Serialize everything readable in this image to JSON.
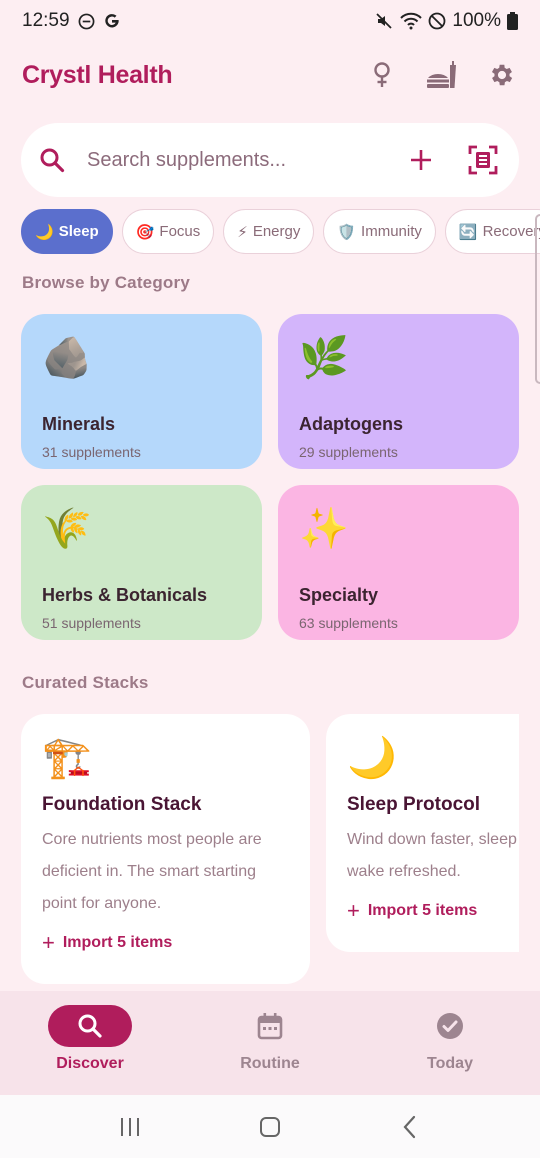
{
  "status_bar": {
    "time": "12:59",
    "battery": "100%"
  },
  "app": {
    "title": "Crystl Health"
  },
  "search": {
    "placeholder": "Search supplements..."
  },
  "chips": [
    {
      "emoji": "🌙",
      "label": "Sleep",
      "active": true
    },
    {
      "emoji": "🎯",
      "label": "Focus",
      "active": false
    },
    {
      "emoji": "⚡",
      "label": "Energy",
      "active": false
    },
    {
      "emoji": "🛡️",
      "label": "Immunity",
      "active": false
    },
    {
      "emoji": "🔄",
      "label": "Recovery",
      "active": false
    }
  ],
  "browse": {
    "title": "Browse by Category",
    "categories": [
      {
        "emoji": "🪨",
        "name": "Minerals",
        "count": "31 supplements",
        "color": "#b5d8fb"
      },
      {
        "emoji": "🌿",
        "name": "Adaptogens",
        "count": "29 supplements",
        "color": "#d3b5fb"
      },
      {
        "emoji": "🌾",
        "name": "Herbs & Botanicals",
        "count": "51 supplements",
        "color": "#cde8c8"
      },
      {
        "emoji": "✨",
        "name": "Specialty",
        "count": "63 supplements",
        "color": "#fbb5e3"
      }
    ]
  },
  "curated": {
    "title": "Curated Stacks",
    "stacks": [
      {
        "emoji": "🏗️",
        "name": "Foundation Stack",
        "desc_lines": [
          "Core nutrients most people are",
          "deficient in. The smart starting",
          "point for anyone."
        ],
        "import_label": "Import 5 items"
      },
      {
        "emoji": "🌙",
        "name": "Sleep Protocol",
        "desc_lines": [
          "Wind down faster, sleep",
          "wake refreshed."
        ],
        "import_label": "Import 5 items"
      }
    ]
  },
  "bottom_nav": [
    {
      "label": "Discover",
      "icon": "search-icon",
      "active": true
    },
    {
      "label": "Routine",
      "icon": "calendar-icon",
      "active": false
    },
    {
      "label": "Today",
      "icon": "check-circle-icon",
      "active": false
    }
  ],
  "colors": {
    "brand": "#b01d5c",
    "background": "#fdeef2",
    "chip_active": "#5b6fcd"
  }
}
